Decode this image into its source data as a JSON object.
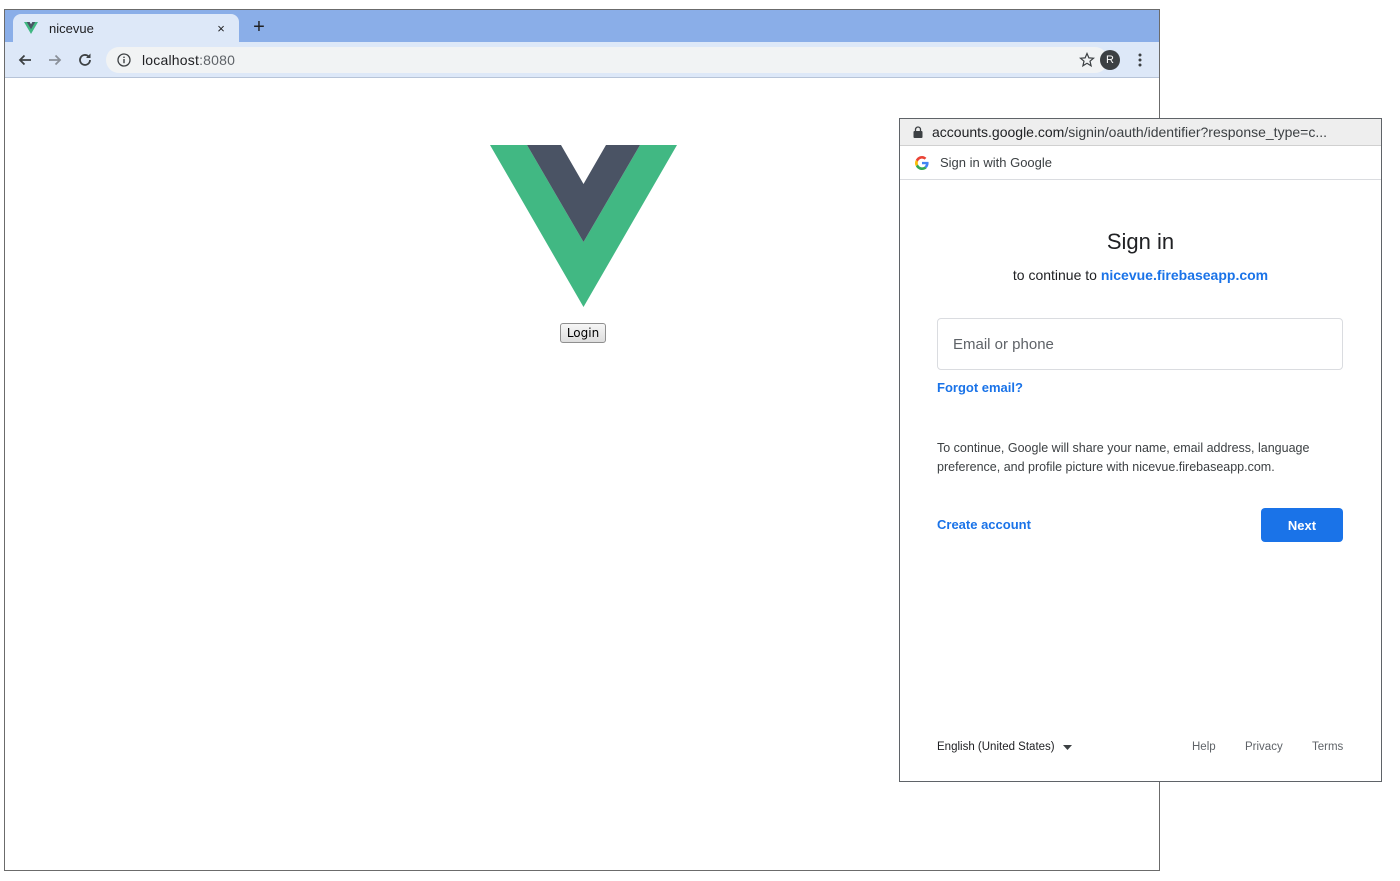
{
  "browser": {
    "tab_title": "nicevue",
    "tab_close": "×",
    "new_tab": "+",
    "url_host": "localhost",
    "url_port": ":8080",
    "avatar_initial": "R"
  },
  "page": {
    "login_label": "Login",
    "logo_colors": {
      "outer": "#41b883",
      "inner": "#4a5364"
    }
  },
  "popup": {
    "url_host": "accounts.google.com",
    "url_path": "/signin/oauth/identifier?response_type=c...",
    "header_text": "Sign in with Google",
    "title": "Sign in",
    "subtitle_prefix": "to continue to ",
    "subtitle_app": "nicevue.firebaseapp.com",
    "email_placeholder": "Email or phone",
    "forgot_email": "Forgot email?",
    "consent_text": "To continue, Google will share your name, email address, language preference, and profile picture with nicevue.firebaseapp.com.",
    "create_account": "Create account",
    "next_label": "Next",
    "footer": {
      "language": "English (United States)",
      "help": "Help",
      "privacy": "Privacy",
      "terms": "Terms"
    }
  },
  "colors": {
    "tabstrip": "#8aaee8",
    "toolbar": "#dde8f8",
    "google_blue": "#1a73e8"
  }
}
